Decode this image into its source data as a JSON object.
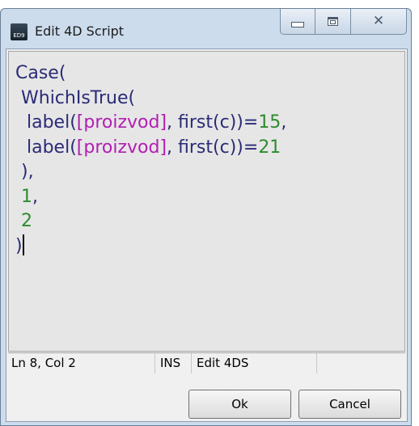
{
  "window": {
    "title": "Edit 4D Script",
    "icon_text": "ED9",
    "icon_name": "edit-4d-script-app-icon"
  },
  "title_buttons": {
    "minimize_icon": "minimize-icon",
    "maximize_icon": "maximize-icon",
    "close_icon": "close-icon",
    "close_glyph": "✕"
  },
  "editor": {
    "lines": [
      [
        {
          "t": "Case(",
          "c": "kw"
        }
      ],
      [
        {
          "t": " WhichIsTrue(",
          "c": "kw"
        }
      ],
      [
        {
          "t": "  label(",
          "c": "fn"
        },
        {
          "t": "[proizvod]",
          "c": "field"
        },
        {
          "t": ", first(c))=",
          "c": "fn"
        },
        {
          "t": "15",
          "c": "num"
        },
        {
          "t": ",",
          "c": "plain"
        }
      ],
      [
        {
          "t": "  label(",
          "c": "fn"
        },
        {
          "t": "[proizvod]",
          "c": "field"
        },
        {
          "t": ", first(c))=",
          "c": "fn"
        },
        {
          "t": "21",
          "c": "num"
        }
      ],
      [
        {
          "t": " ),",
          "c": "plain"
        }
      ],
      [
        {
          "t": " 1",
          "c": "num"
        },
        {
          "t": ",",
          "c": "plain"
        }
      ],
      [
        {
          "t": " 2",
          "c": "num"
        }
      ],
      [
        {
          "t": ")",
          "c": "plain"
        }
      ]
    ],
    "colors": {
      "keyword": "#2b2b78",
      "field": "#b21eb2",
      "number": "#2e8b2e"
    }
  },
  "statusbar": {
    "position": "Ln 8, Col 2",
    "insert_mode": "INS",
    "mode": "Edit 4DS",
    "extra": ""
  },
  "buttons": {
    "ok_label": "Ok",
    "cancel_label": "Cancel"
  }
}
